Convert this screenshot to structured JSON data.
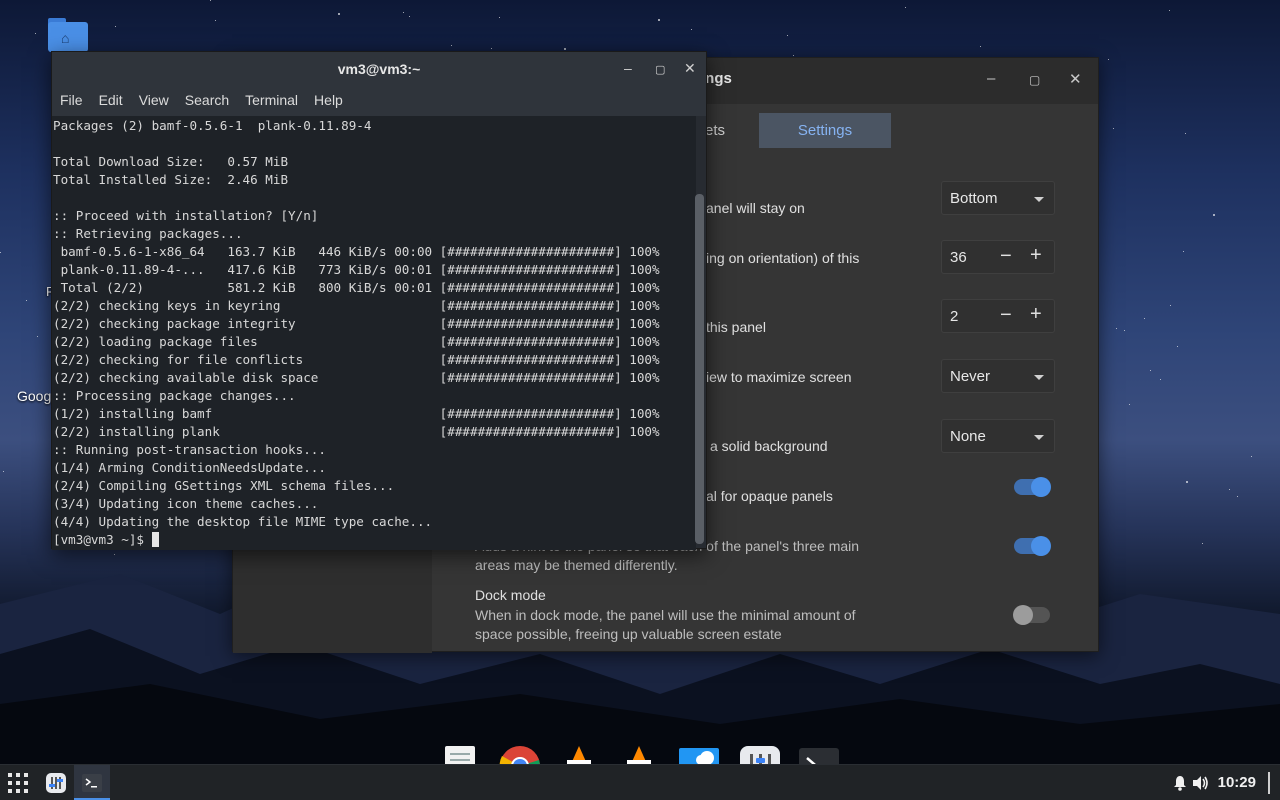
{
  "desktop": {
    "icons": [
      {
        "label": "Goog"
      },
      {
        "label": "F"
      }
    ]
  },
  "settings_window": {
    "title": "ttings",
    "tabs": [
      {
        "label": "ets"
      },
      {
        "label": "Settings"
      }
    ],
    "rows": [
      {
        "text": "anel will stay on",
        "control": "Bottom"
      },
      {
        "text": "ing on orientation) of this",
        "control": "36"
      },
      {
        "text": "this panel",
        "control": "2"
      },
      {
        "text": "iew to maximize screen",
        "control": "Never"
      },
      {
        "text": "a solid background",
        "control": "None"
      },
      {
        "text": "al for opaque panels",
        "toggle": "on"
      },
      {
        "text": "Adds a hint to the panel so that each of the panel's three main",
        "text2": "areas may be themed differently.",
        "toggle": "on"
      },
      {
        "title": "Dock mode",
        "text": "When in dock mode, the panel will use the minimal amount of",
        "text2": "space possible, freeing up valuable screen estate",
        "toggle": "off"
      }
    ]
  },
  "terminal": {
    "title": "vm3@vm3:~",
    "menu": [
      "File",
      "Edit",
      "View",
      "Search",
      "Terminal",
      "Help"
    ],
    "lines": [
      "Packages (2) bamf-0.5.6-1  plank-0.11.89-4",
      "",
      "Total Download Size:   0.57 MiB",
      "Total Installed Size:  2.46 MiB",
      "",
      ":: Proceed with installation? [Y/n]",
      ":: Retrieving packages...",
      " bamf-0.5.6-1-x86_64   163.7 KiB   446 KiB/s 00:00 [######################] 100%",
      " plank-0.11.89-4-...   417.6 KiB   773 KiB/s 00:01 [######################] 100%",
      " Total (2/2)           581.2 KiB   800 KiB/s 00:01 [######################] 100%",
      "(2/2) checking keys in keyring                     [######################] 100%",
      "(2/2) checking package integrity                   [######################] 100%",
      "(2/2) loading package files                        [######################] 100%",
      "(2/2) checking for file conflicts                  [######################] 100%",
      "(2/2) checking available disk space                [######################] 100%",
      ":: Processing package changes...",
      "(1/2) installing bamf                              [######################] 100%",
      "(2/2) installing plank                             [######################] 100%",
      ":: Running post-transaction hooks...",
      "(1/4) Arming ConditionNeedsUpdate...",
      "(2/4) Compiling GSettings XML schema files...",
      "(3/4) Updating icon theme caches...",
      "(4/4) Updating the desktop file MIME type cache..."
    ],
    "prompt": "[vm3@vm3 ~]$ "
  },
  "taskbar": {
    "clock": "10:29"
  },
  "dock": {
    "items": [
      "text-editor-icon",
      "chrome-icon",
      "vlc-icon",
      "vlc-icon",
      "image-viewer-icon",
      "settings-mixer-icon",
      "terminal-icon"
    ]
  },
  "colors": {
    "accent": "#4a90e8",
    "terminal_bg": "#1e2227",
    "window_bg": "#353535"
  }
}
